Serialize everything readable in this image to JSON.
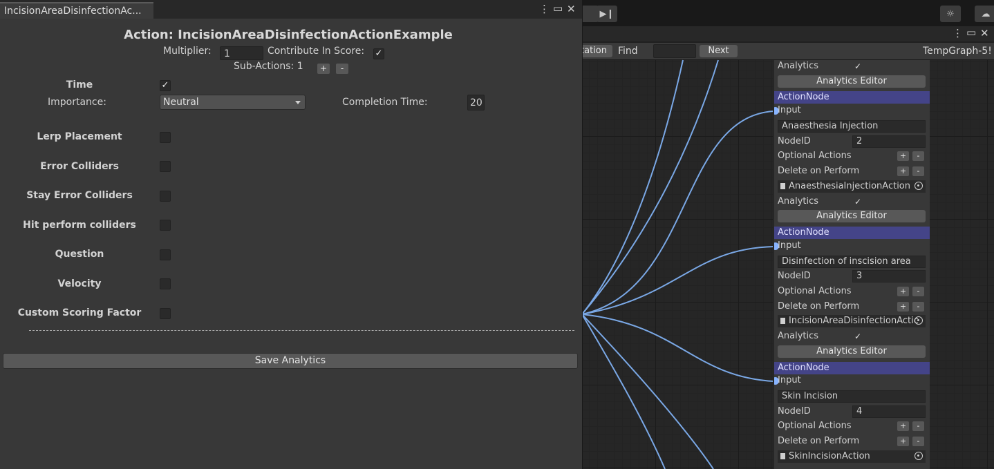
{
  "inspector": {
    "tab_title": "IncisionAreaDisinfectionAc...",
    "heading": "Action: IncisionAreaDisinfectionActionExample",
    "multiplier_label": "Multiplier:",
    "multiplier_value": "1",
    "contribute_label": "Contribute In Score:",
    "contribute_checked": "✓",
    "subactions_label": "Sub-Actions: 1",
    "plus": "+",
    "minus": "-",
    "time_label": "Time",
    "time_checked": "✓",
    "importance_label": "Importance:",
    "importance_value": "Neutral",
    "completion_label": "Completion Time:",
    "completion_value": "20",
    "options": [
      {
        "label": "Lerp Placement"
      },
      {
        "label": "Error Colliders"
      },
      {
        "label": "Stay Error Colliders"
      },
      {
        "label": "Hit perform colliders"
      },
      {
        "label": "Question"
      },
      {
        "label": "Velocity"
      },
      {
        "label": "Custom Scoring Factor"
      }
    ],
    "save_label": "Save Analytics",
    "menu_icon": "⋮",
    "maximize_icon": "▭",
    "close_icon": "✕"
  },
  "graph": {
    "toolbar_partial_button": "tation",
    "find_label": "Find",
    "find_value": "",
    "next_label": "Next",
    "graph_name": "TempGraph-5!",
    "analytics_label": "Analytics",
    "analytics_check": "✓",
    "analytics_editor": "Analytics Editor",
    "action_node_header": "ActionNode",
    "input_label": "Input",
    "nodeid_label": "NodeID",
    "optional_actions_label": "Optional Actions",
    "delete_on_perform_label": "Delete on Perform",
    "nodes": [
      {
        "name": "Anaesthesia Injection",
        "id": "2",
        "script": "AnaesthesiaInjectionAction"
      },
      {
        "name": "Disinfection of inscision area",
        "id": "3",
        "script": "IncisionAreaDisinfectionActic"
      },
      {
        "name": "Skin Incision",
        "id": "4",
        "script": "SkinIncisionAction"
      }
    ]
  },
  "colors": {
    "node_header": "#444488",
    "edge": "#7aa8e6",
    "panel": "#383838"
  }
}
